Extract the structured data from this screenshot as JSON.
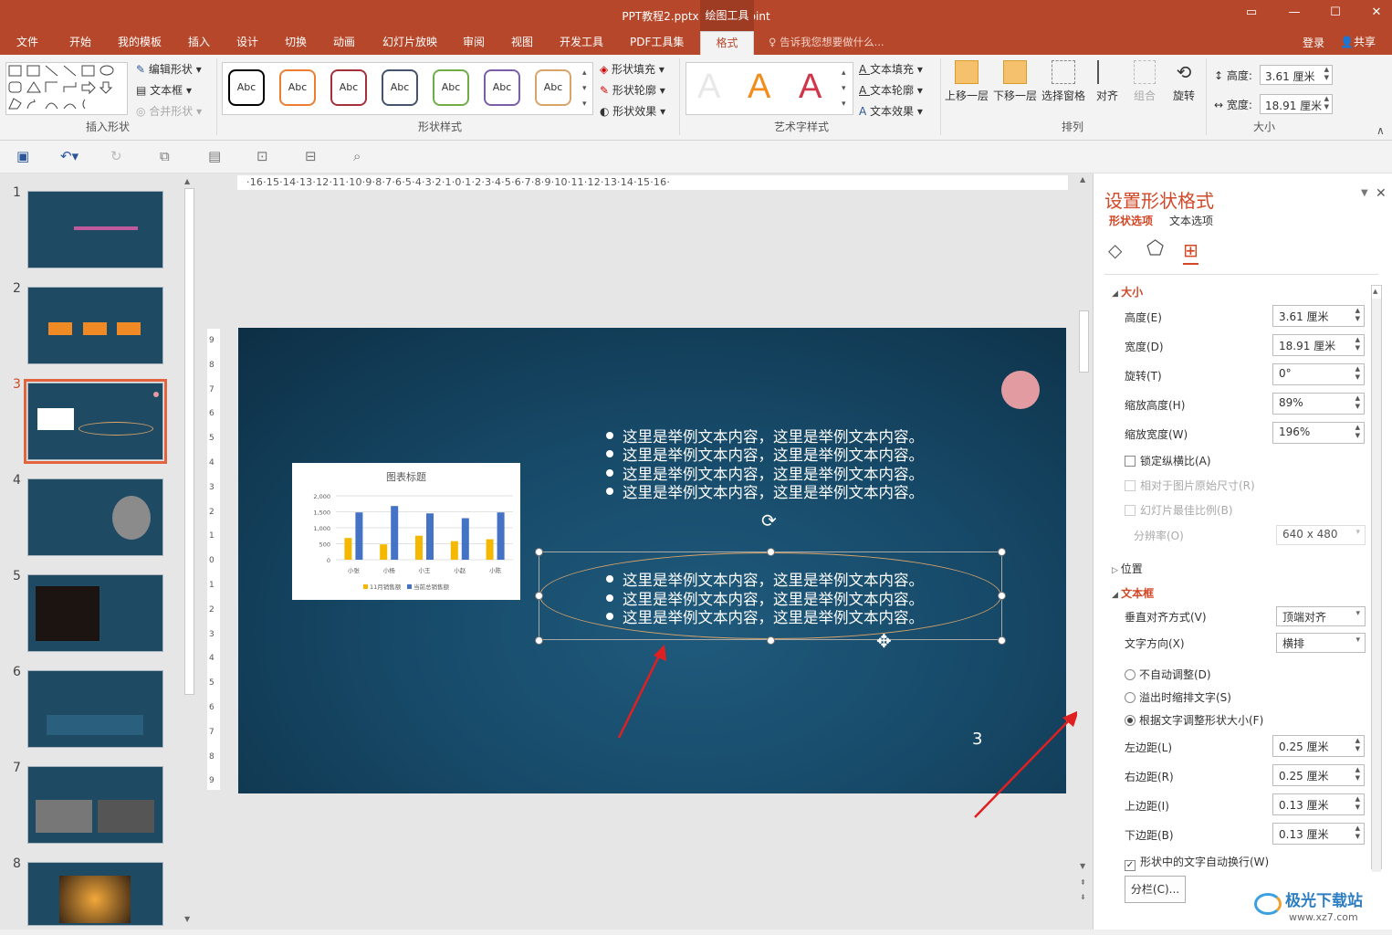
{
  "window": {
    "title": "PPT教程2.pptx - PowerPoint",
    "context_tab": "绘图工具",
    "controls": [
      "▭",
      "—",
      "☐",
      "✕"
    ]
  },
  "tabs": [
    "文件",
    "开始",
    "我的模板",
    "插入",
    "设计",
    "切换",
    "动画",
    "幻灯片放映",
    "审阅",
    "视图",
    "开发工具",
    "PDF工具集",
    "格式"
  ],
  "active_tab": "格式",
  "tell_me": "告诉我您想要做什么...",
  "account": {
    "login": "登录",
    "share": "共享"
  },
  "ribbon": {
    "insert_shapes": {
      "label": "插入形状",
      "edit_shape": "编辑形状",
      "text_box": "文本框",
      "merge_shapes": "合并形状"
    },
    "shape_styles": {
      "label": "形状样式",
      "sample": "Abc",
      "colors": [
        "#000000",
        "#ed7d31",
        "#a5303a",
        "#44546a",
        "#70ad47",
        "#7b5ea7",
        "#d9a46a"
      ],
      "fill": "形状填充",
      "outline": "形状轮廓",
      "effects": "形状效果"
    },
    "wordart": {
      "label": "艺术字样式",
      "text_fill": "文本填充",
      "text_outline": "文本轮廓",
      "text_effects": "文本效果"
    },
    "arrange": {
      "label": "排列",
      "bring_forward": "上移一层",
      "send_backward": "下移一层",
      "selection_pane": "选择窗格",
      "align": "对齐",
      "group": "组合",
      "rotate": "旋转"
    },
    "size": {
      "label": "大小",
      "height_label": "高度:",
      "height": "3.61 厘米",
      "width_label": "宽度:",
      "width": "18.91 厘米"
    }
  },
  "thumbnails": [
    "1",
    "2",
    "3",
    "4",
    "5",
    "6",
    "7",
    "8"
  ],
  "selected_slide": "3",
  "ruler": "·16·15·14·13·12·11·10·9·8·7·6·5·4·3·2·1·0·1·2·3·4·5·6·7·8·9·10·11·12·13·14·15·16·",
  "slide": {
    "bullets_top": [
      "这里是举例文本内容，这里是举例文本内容。",
      "这里是举例文本内容，这里是举例文本内容。",
      "这里是举例文本内容，这里是举例文本内容。",
      "这里是举例文本内容，这里是举例文本内容。"
    ],
    "bullets_ellipse": [
      "这里是举例文本内容，这里是举例文本内容。",
      "这里是举例文本内容，这里是举例文本内容。",
      "这里是举例文本内容，这里是举例文本内容。"
    ],
    "page_number": "3"
  },
  "chart_data": {
    "type": "bar",
    "title": "图表标题",
    "categories": [
      "小张",
      "小杨",
      "小王",
      "小赵",
      "小陈"
    ],
    "series": [
      {
        "name": "11月销售额",
        "color": "#f5b800",
        "values": [
          680,
          480,
          750,
          580,
          640
        ]
      },
      {
        "name": "当前总销售额",
        "color": "#4472c4",
        "values": [
          1480,
          1680,
          1450,
          1300,
          1480
        ]
      }
    ],
    "yticks": [
      "2,000",
      "1,500",
      "1,000",
      "500",
      "0"
    ],
    "ylim": [
      0,
      2000
    ]
  },
  "panel": {
    "title": "设置形状格式",
    "tab_shape": "形状选项",
    "tab_text": "文本选项",
    "section_size": "大小",
    "height_label": "高度(E)",
    "height": "3.61 厘米",
    "width_label": "宽度(D)",
    "width": "18.91 厘米",
    "rotation_label": "旋转(T)",
    "rotation": "0°",
    "scale_h_label": "缩放高度(H)",
    "scale_h": "89%",
    "scale_w_label": "缩放宽度(W)",
    "scale_w": "196%",
    "lock_ratio": "锁定纵横比(A)",
    "relative_orig": "相对于图片原始尺寸(R)",
    "best_scale": "幻灯片最佳比例(B)",
    "resolution_label": "分辨率(O)",
    "resolution": "640 x 480",
    "section_position": "位置",
    "section_textbox": "文本框",
    "valign_label": "垂直对齐方式(V)",
    "valign": "顶端对齐",
    "text_dir_label": "文字方向(X)",
    "text_dir": "横排",
    "no_autofit": "不自动调整(D)",
    "shrink_overflow": "溢出时缩排文字(S)",
    "resize_shape": "根据文字调整形状大小(F)",
    "left_margin_label": "左边距(L)",
    "left_margin": "0.25 厘米",
    "right_margin_label": "右边距(R)",
    "right_margin": "0.25 厘米",
    "top_margin_label": "上边距(I)",
    "top_margin": "0.13 厘米",
    "bottom_margin_label": "下边距(B)",
    "bottom_margin": "0.13 厘米",
    "wrap_text": "形状中的文字自动换行(W)",
    "columns_button": "分栏(C)..."
  },
  "watermark": "极光下载站 www.xz7.com"
}
